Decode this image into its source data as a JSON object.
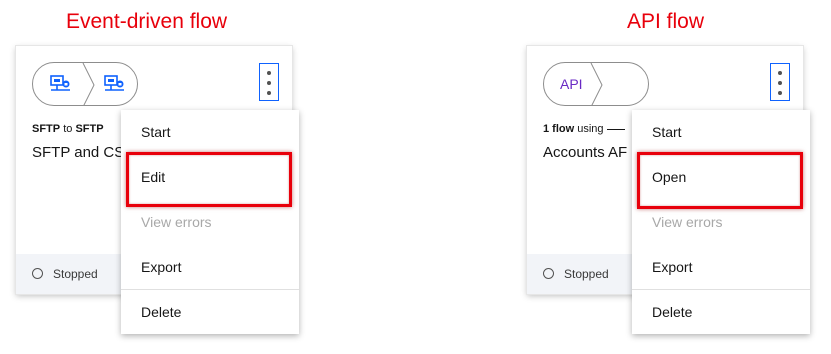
{
  "left": {
    "heading": "Event-driven flow",
    "card": {
      "source": "SFTP",
      "connector": "to",
      "target": "SFTP",
      "name": "SFTP and CS",
      "status": "Stopped"
    },
    "menu": {
      "items": [
        {
          "label": "Start",
          "disabled": false
        },
        {
          "label": "Edit",
          "disabled": false
        },
        {
          "label": "View errors",
          "disabled": true
        },
        {
          "label": "Export",
          "disabled": false
        },
        {
          "label": "Delete",
          "disabled": false
        }
      ]
    }
  },
  "right": {
    "heading": "API flow",
    "card": {
      "api_label": "API",
      "count_label": "1 flow",
      "using": "using",
      "name": "Accounts AF",
      "status": "Stopped"
    },
    "menu": {
      "items": [
        {
          "label": "Start",
          "disabled": false
        },
        {
          "label": "Open",
          "disabled": false
        },
        {
          "label": "View errors",
          "disabled": true
        },
        {
          "label": "Export",
          "disabled": false
        },
        {
          "label": "Delete",
          "disabled": false
        }
      ]
    }
  },
  "colors": {
    "annotation_red": "#e8000b",
    "kebab_focus": "#0f62fe",
    "api_purple": "#6929c4"
  },
  "icons": {
    "sftp": "sftp-server-icon",
    "menu": "overflow-menu-vertical-icon",
    "status": "status-stopped-circle-icon"
  }
}
